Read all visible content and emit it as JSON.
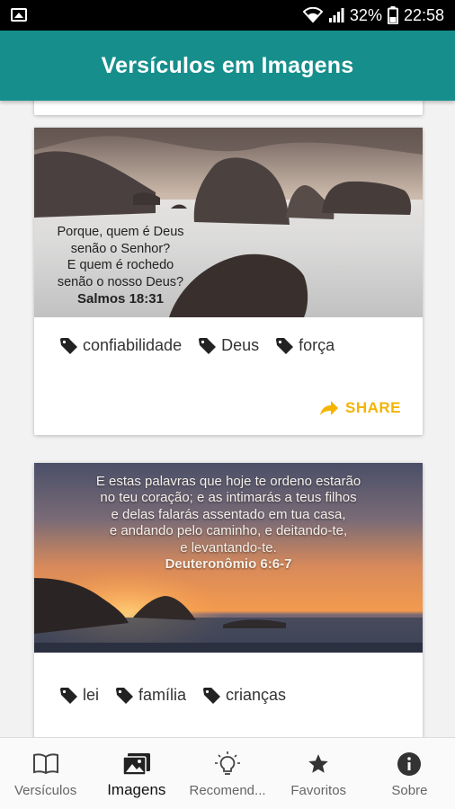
{
  "status": {
    "battery": "32%",
    "time": "22:58"
  },
  "appbar": {
    "title": "Versículos em Imagens"
  },
  "cards": [
    {
      "verse_lines": [
        "Porque, quem é Deus",
        "senão o Senhor?",
        "E quem é rochedo",
        "senão o nosso Deus?"
      ],
      "reference": "Salmos 18:31",
      "tags": [
        "confiabilidade",
        "Deus",
        "força"
      ],
      "share_label": "SHARE"
    },
    {
      "verse_lines": [
        "E estas palavras que hoje te ordeno estarão",
        "no teu coração; e as intimarás a teus filhos",
        "e delas falarás assentado em tua casa,",
        "e andando pelo caminho, e deitando-te,",
        "e levantando-te."
      ],
      "reference": "Deuteronômio 6:6-7",
      "tags": [
        "lei",
        "família",
        "crianças"
      ]
    }
  ],
  "bottom_nav": [
    {
      "label": "Versículos",
      "icon": "book-icon"
    },
    {
      "label": "Imagens",
      "icon": "images-icon",
      "active": true
    },
    {
      "label": "Recomend...",
      "icon": "lightbulb-icon"
    },
    {
      "label": "Favoritos",
      "icon": "star-icon"
    },
    {
      "label": "Sobre",
      "icon": "info-icon"
    }
  ],
  "colors": {
    "primary": "#168f8c",
    "accent": "#f4b400"
  }
}
